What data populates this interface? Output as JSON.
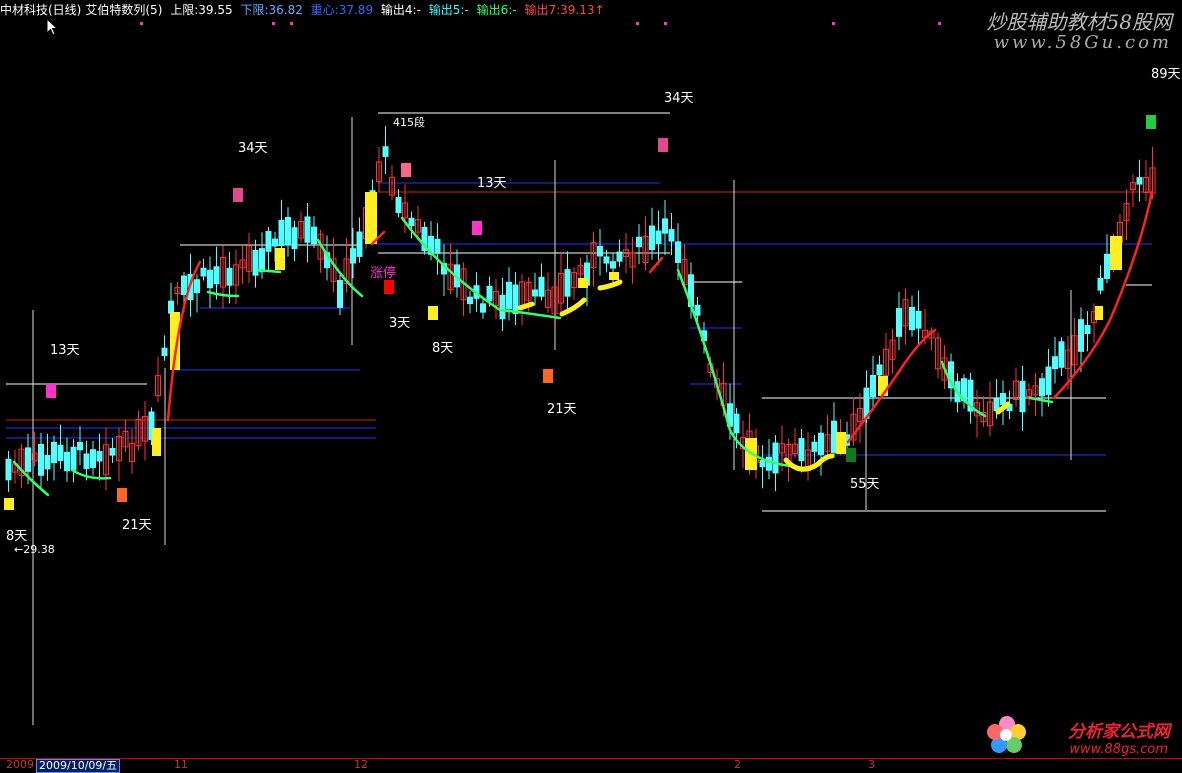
{
  "header": {
    "stock": "中材科技(日线)",
    "indicator": "艾伯特数列(5)",
    "upper_label": "上限:",
    "upper_value": "39.55",
    "lower_label": "下限:",
    "lower_value": "36.82",
    "center_label": "重心:",
    "center_value": "37.89",
    "out4": "输出4:-",
    "out5": "输出5:-",
    "out6": "输出6:-",
    "out7": "输出7:39.13↑"
  },
  "watermark": {
    "top_line1": "炒股辅助教材58股网",
    "top_line2": "www.58Gu.com",
    "bottom_line1": "分析家公式网",
    "bottom_line2": "www.88gs.com"
  },
  "annotations": [
    {
      "id": "d89",
      "text": "89天"
    },
    {
      "id": "d34a",
      "text": "34天"
    },
    {
      "id": "d34b",
      "text": "34天"
    },
    {
      "id": "d13a",
      "text": "13天"
    },
    {
      "id": "d13b",
      "text": "13天"
    },
    {
      "id": "d8a",
      "text": "8天"
    },
    {
      "id": "d8b",
      "text": "8天"
    },
    {
      "id": "d3",
      "text": "3天"
    },
    {
      "id": "d21a",
      "text": "21天"
    },
    {
      "id": "d21b",
      "text": "21天"
    },
    {
      "id": "d55",
      "text": "55天"
    },
    {
      "id": "zhangting",
      "text": "涨停"
    },
    {
      "id": "p415",
      "text": "415段"
    },
    {
      "id": "low",
      "text": "←29.38"
    }
  ],
  "xaxis": {
    "y2009": "2009",
    "selected_date": "2009/10/09/五",
    "m11": "11",
    "m12": "12",
    "m2": "2",
    "m3": "3"
  },
  "colors": {
    "up": "#ff3333",
    "down": "#55ffff",
    "yellow": "#ffee22",
    "green_line": "#33ff66",
    "red_line": "#ff2222",
    "hline_blue": "#2233ff",
    "hline_red": "#cc2222",
    "hline_white": "#ffffff",
    "magenta": "#ff33cc"
  }
}
